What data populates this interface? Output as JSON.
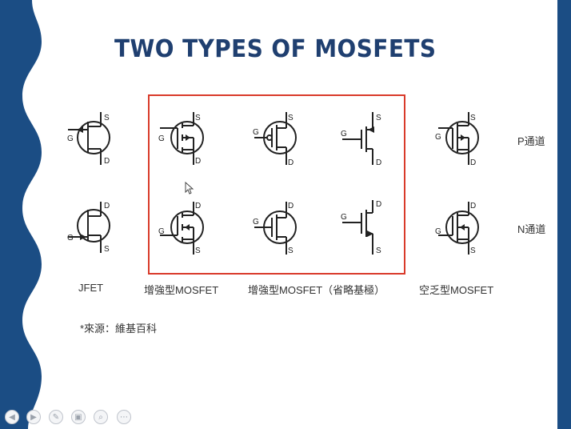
{
  "slide": {
    "title": "TWO TYPES OF MOSFETS",
    "captions": {
      "jfet": "JFET",
      "enhancement": "增強型MOSFET",
      "enhancement_simplified": "增強型MOSFET（省略基極）",
      "depletion": "空乏型MOSFET"
    },
    "channel_labels": {
      "p": "P通道",
      "n": "N通道"
    },
    "source_note": "*來源：維基百科",
    "colors": {
      "accent_dark": "#1b4d84",
      "title": "#1f3f70",
      "highlight": "#d93a2a"
    }
  },
  "toolbar": {
    "buttons": [
      {
        "name": "previous-slide-button",
        "icon": "triangle-left-icon",
        "glyph": "◀"
      },
      {
        "name": "next-slide-button",
        "icon": "triangle-right-icon",
        "glyph": "▶"
      },
      {
        "name": "pen-button",
        "icon": "pen-icon",
        "glyph": "✎"
      },
      {
        "name": "slides-button",
        "icon": "slides-icon",
        "glyph": "▣"
      },
      {
        "name": "zoom-button",
        "icon": "magnifier-icon",
        "glyph": "⌕"
      },
      {
        "name": "more-button",
        "icon": "ellipsis-icon",
        "glyph": "⋯"
      }
    ]
  }
}
